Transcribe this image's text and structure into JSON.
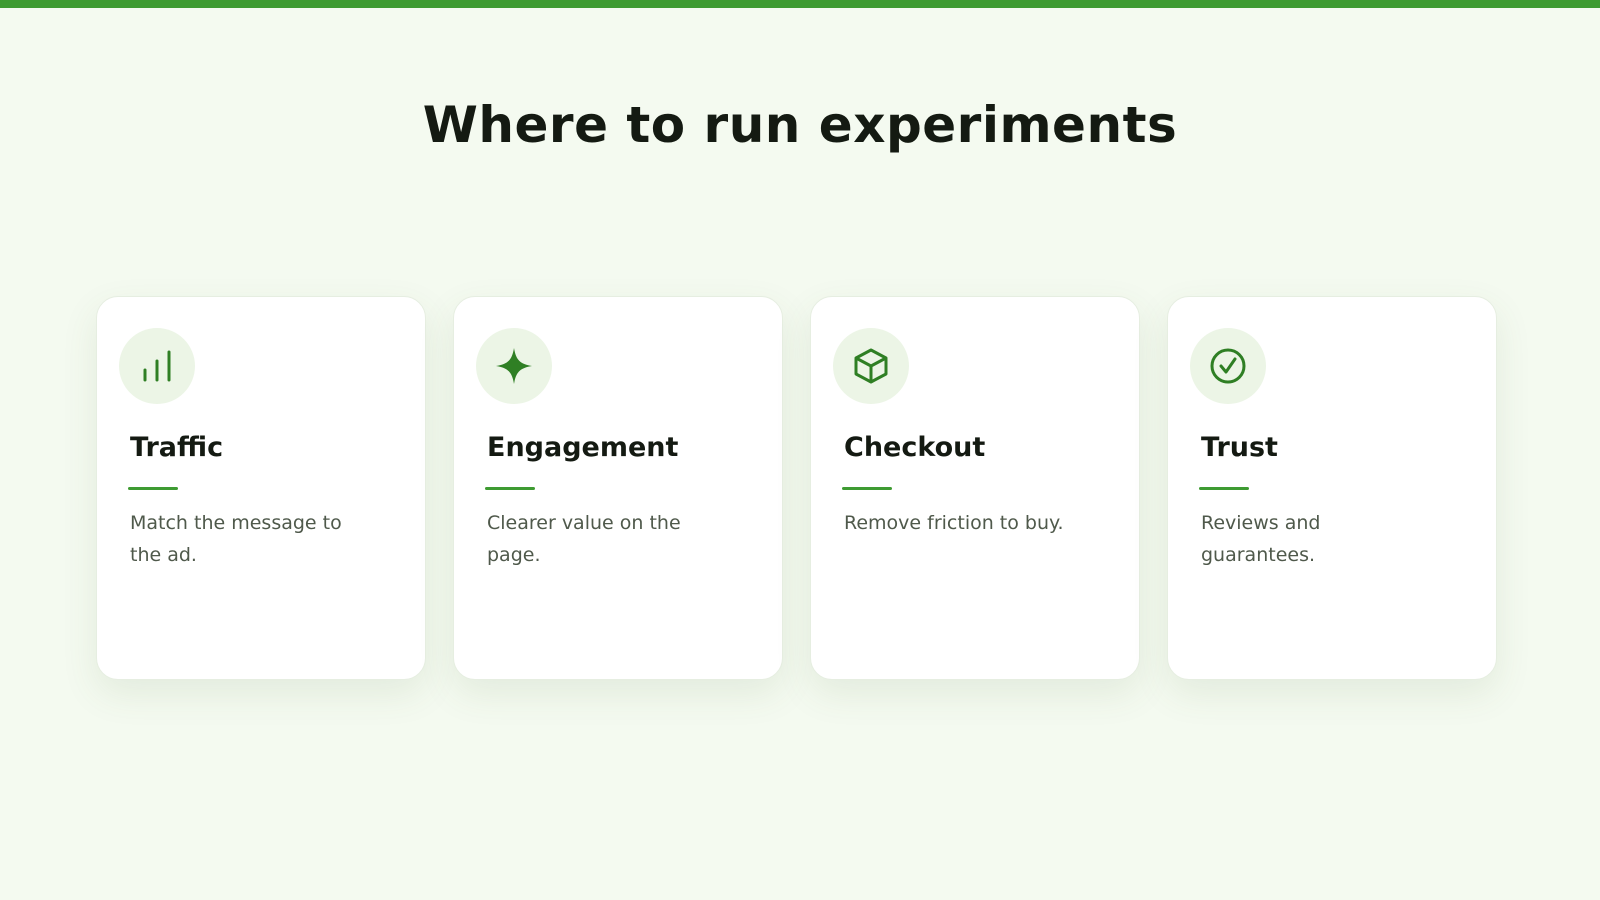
{
  "title": "Where to run experiments",
  "colors": {
    "accent": "#3e9b32",
    "icon": "#2f7f24",
    "icon_bg": "#ecf5e6",
    "background": "#f4faf0",
    "card": "#ffffff"
  },
  "cards": [
    {
      "title": "Traffic",
      "description": "Match the message to the ad.",
      "icon": "bar-chart-icon"
    },
    {
      "title": "Engagement",
      "description": "Clearer value on the page.",
      "icon": "sparkle-icon"
    },
    {
      "title": "Checkout",
      "description": "Remove friction to buy.",
      "icon": "box-icon"
    },
    {
      "title": "Trust",
      "description": "Reviews and guarantees.",
      "icon": "check-circle-icon"
    }
  ]
}
